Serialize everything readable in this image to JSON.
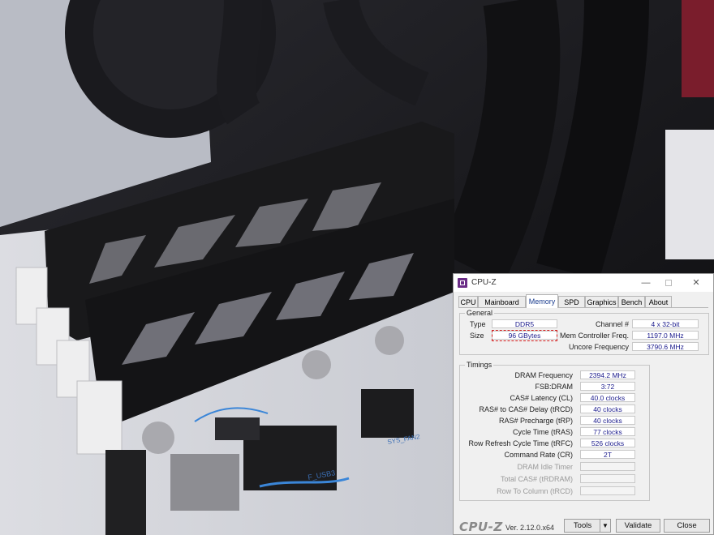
{
  "window": {
    "title": "CPU-Z",
    "controls": {
      "minimize": "—",
      "close": "✕"
    }
  },
  "tabs": [
    {
      "label": "CPU",
      "active": false
    },
    {
      "label": "Mainboard",
      "active": false
    },
    {
      "label": "Memory",
      "active": true
    },
    {
      "label": "SPD",
      "active": false
    },
    {
      "label": "Graphics",
      "active": false
    },
    {
      "label": "Bench",
      "active": false
    },
    {
      "label": "About",
      "active": false
    }
  ],
  "general": {
    "label": "General",
    "type_label": "Type",
    "type_value": "DDR5",
    "size_label": "Size",
    "size_value": "96 GBytes",
    "channel_label": "Channel #",
    "channel_value": "4 x 32-bit",
    "mem_ctrl_label": "Mem Controller Freq.",
    "mem_ctrl_value": "1197.0 MHz",
    "uncore_label": "Uncore Frequency",
    "uncore_value": "3790.6 MHz"
  },
  "timings": {
    "label": "Timings",
    "rows": [
      {
        "label": "DRAM Frequency",
        "value": "2394.2 MHz",
        "enabled": true
      },
      {
        "label": "FSB:DRAM",
        "value": "3:72",
        "enabled": true
      },
      {
        "label": "CAS# Latency (CL)",
        "value": "40.0 clocks",
        "enabled": true
      },
      {
        "label": "RAS# to CAS# Delay (tRCD)",
        "value": "40 clocks",
        "enabled": true
      },
      {
        "label": "RAS# Precharge (tRP)",
        "value": "40 clocks",
        "enabled": true
      },
      {
        "label": "Cycle Time (tRAS)",
        "value": "77 clocks",
        "enabled": true
      },
      {
        "label": "Row Refresh Cycle Time (tRFC)",
        "value": "526 clocks",
        "enabled": true
      },
      {
        "label": "Command Rate (CR)",
        "value": "2T",
        "enabled": true
      },
      {
        "label": "DRAM Idle Timer",
        "value": "",
        "enabled": false
      },
      {
        "label": "Total CAS# (tRDRAM)",
        "value": "",
        "enabled": false
      },
      {
        "label": "Row To Column (tRCD)",
        "value": "",
        "enabled": false
      }
    ]
  },
  "footer": {
    "logo": "CPU-Z",
    "version": "Ver. 2.12.0.x64",
    "tools_label": "Tools",
    "tools_arrow": "▼",
    "validate_label": "Validate",
    "close_label": "Close"
  },
  "photo_labels": {
    "usb_header": "F_USB3",
    "fan_header": "SYS_FAN2"
  },
  "colors": {
    "accent_tab": "#1b3d8f",
    "value_text": "#1a1a8c",
    "highlight": "#d41c1c"
  }
}
